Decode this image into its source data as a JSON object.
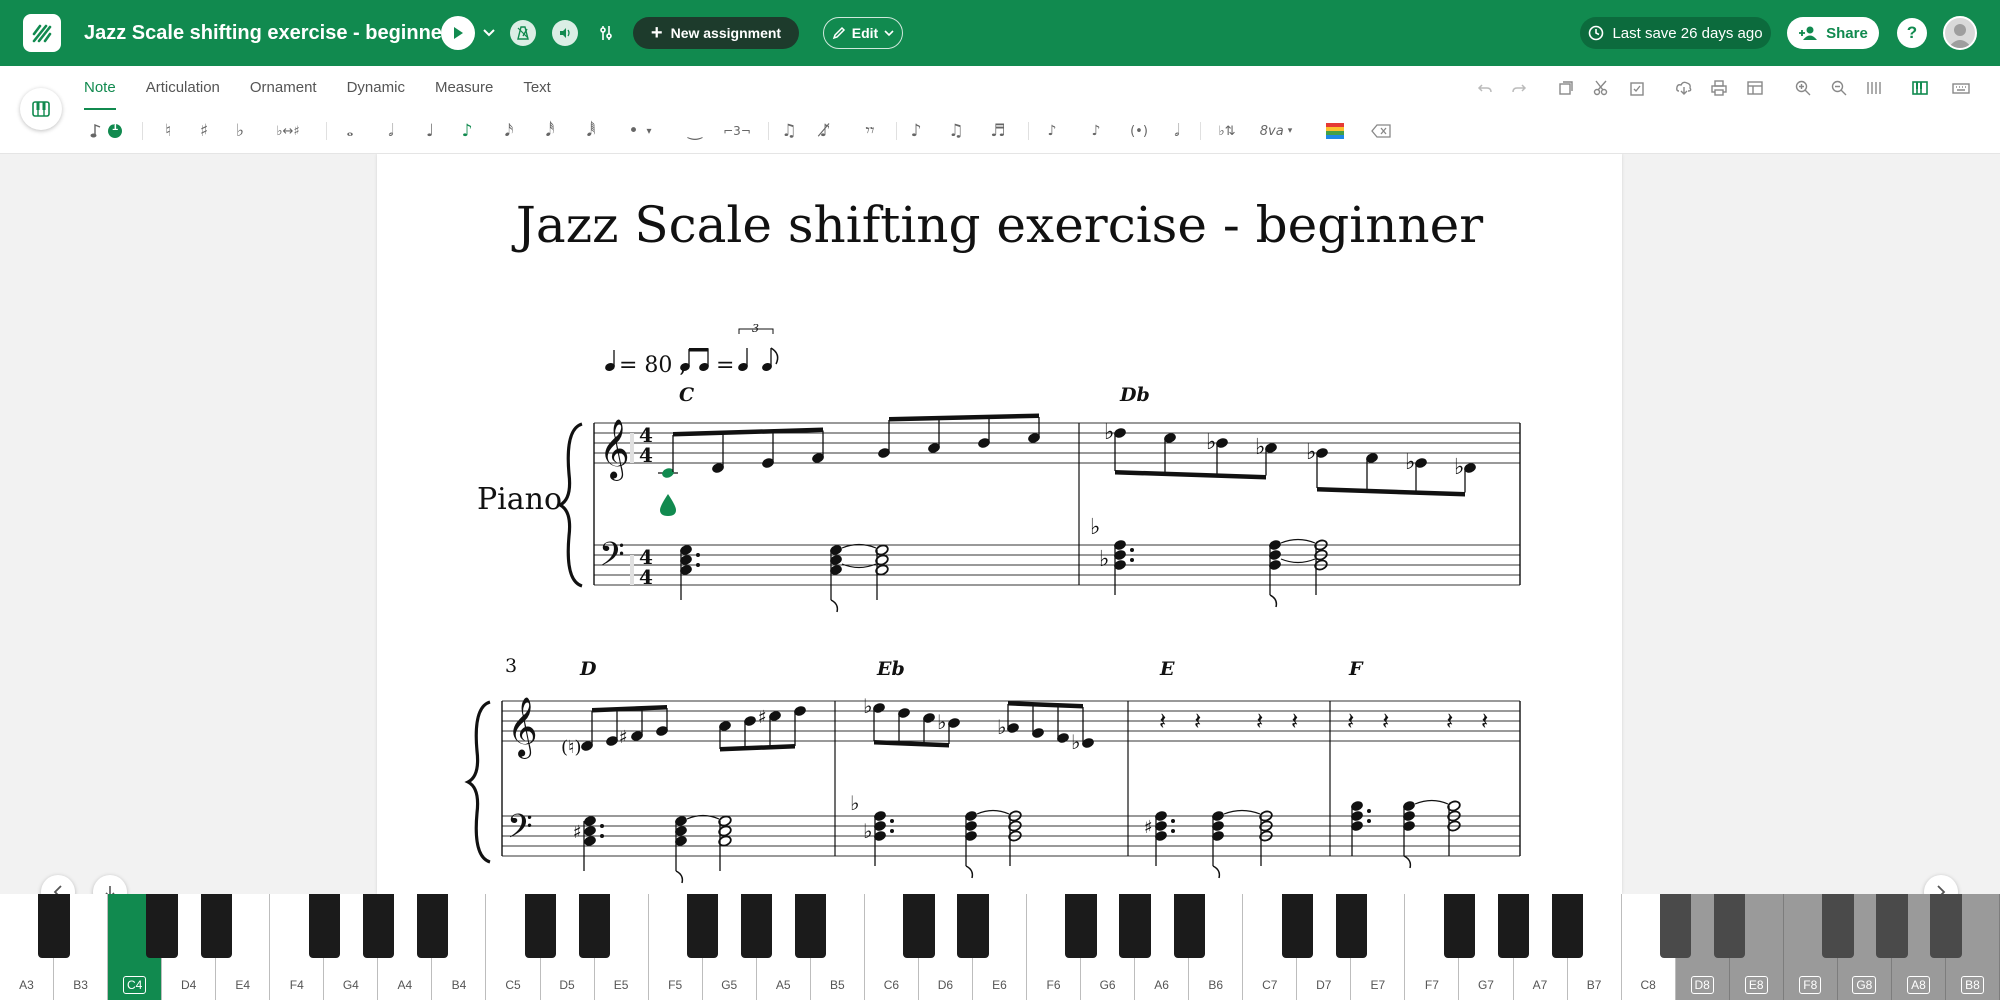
{
  "header": {
    "title": "Jazz Scale shifting exercise - beginner",
    "new_assignment_label": "New assignment",
    "edit_label": "Edit",
    "last_save": "Last save 26 days ago",
    "share_label": "Share",
    "help_label": "?"
  },
  "tabs": [
    "Note",
    "Articulation",
    "Ornament",
    "Dynamic",
    "Measure",
    "Text"
  ],
  "active_tab": "Note",
  "note_toolbar": {
    "voice_badge": "1",
    "tuplet_label": "3",
    "ottava_label": "8va"
  },
  "score": {
    "title": "Jazz Scale shifting exercise - beginner",
    "tempo_mark": "= 80 ,",
    "swing_equals": "=",
    "tuplet_number": "3",
    "instrument": "Piano",
    "time_sig_top": "4",
    "time_sig_bottom": "4",
    "system2_measure_number": "3",
    "chords": [
      "C",
      "Db",
      "D",
      "Eb",
      "E",
      "F"
    ]
  },
  "keyboard": {
    "white_keys": [
      "A3",
      "B3",
      "C4",
      "D4",
      "E4",
      "F4",
      "G4",
      "A4",
      "B4",
      "C5",
      "D5",
      "E5",
      "F5",
      "G5",
      "A5",
      "B5",
      "C6",
      "D6",
      "E6",
      "F6",
      "G6",
      "A6",
      "B6",
      "C7",
      "D7",
      "E7",
      "F7",
      "G7",
      "A7",
      "B7",
      "C8",
      "D8",
      "E8",
      "F8",
      "G8",
      "A8",
      "B8"
    ],
    "active_key": "C4",
    "out_of_range_from": "D8"
  },
  "colors": {
    "brand_green": "#118a4f",
    "dark_pill": "#1d3b2c",
    "save_pill": "#0c6b3d"
  },
  "icons": {
    "logo": "flat-logo-icon",
    "play": "play-icon",
    "metronome": "metronome-icon",
    "volume": "volume-icon",
    "mixer": "mixer-icon"
  }
}
